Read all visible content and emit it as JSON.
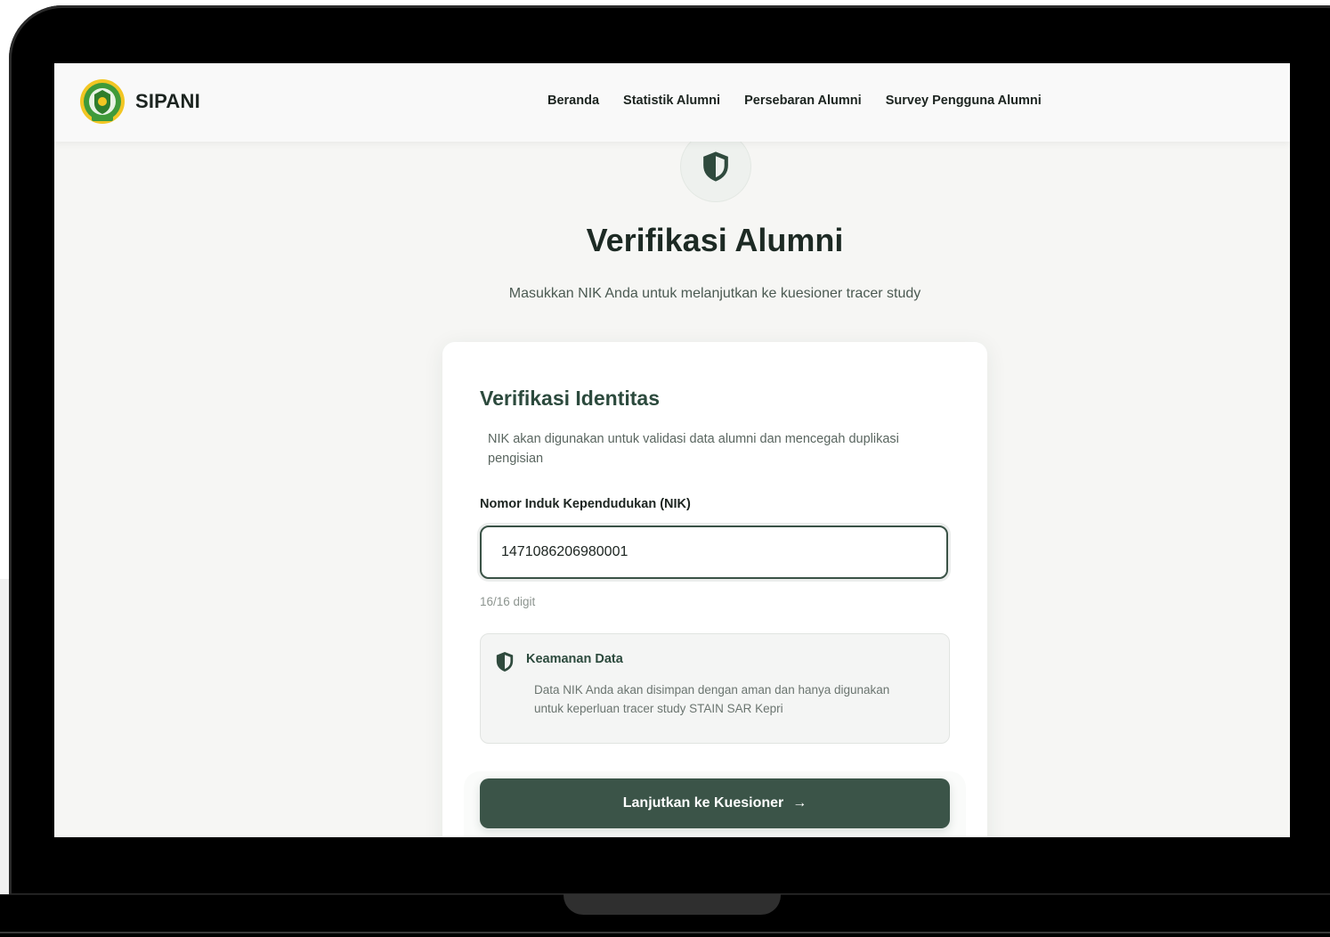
{
  "navbar": {
    "brand": "SIPANI",
    "links": [
      "Beranda",
      "Statistik Alumni",
      "Persebaran Alumni",
      "Survey Pengguna Alumni"
    ]
  },
  "hero": {
    "icon": "shield-icon",
    "title": "Verifikasi Alumni",
    "subtitle": "Masukkan NIK Anda untuk melanjutkan ke kuesioner tracer study"
  },
  "card": {
    "title": "Verifikasi Identitas",
    "description": "NIK akan digunakan untuk validasi data alumni dan mencegah duplikasi pengisian",
    "field_label": "Nomor Induk Kependudukan (NIK)",
    "nik_value": "1471086206980001",
    "digit_counter": "16/16 digit",
    "security": {
      "icon": "shield-icon",
      "title": "Keamanan Data",
      "text": "Data NIK Anda akan disimpan dengan aman dan hanya digunakan untuk keperluan tracer study STAIN SAR Kepri"
    },
    "button": {
      "label": "Lanjutkan ke Kuesioner",
      "arrow": "→"
    }
  },
  "colors": {
    "primary": "#3b5448",
    "heading": "#1d2a24",
    "accent_text": "#2c4a3d",
    "background": "#f6f6f4"
  }
}
